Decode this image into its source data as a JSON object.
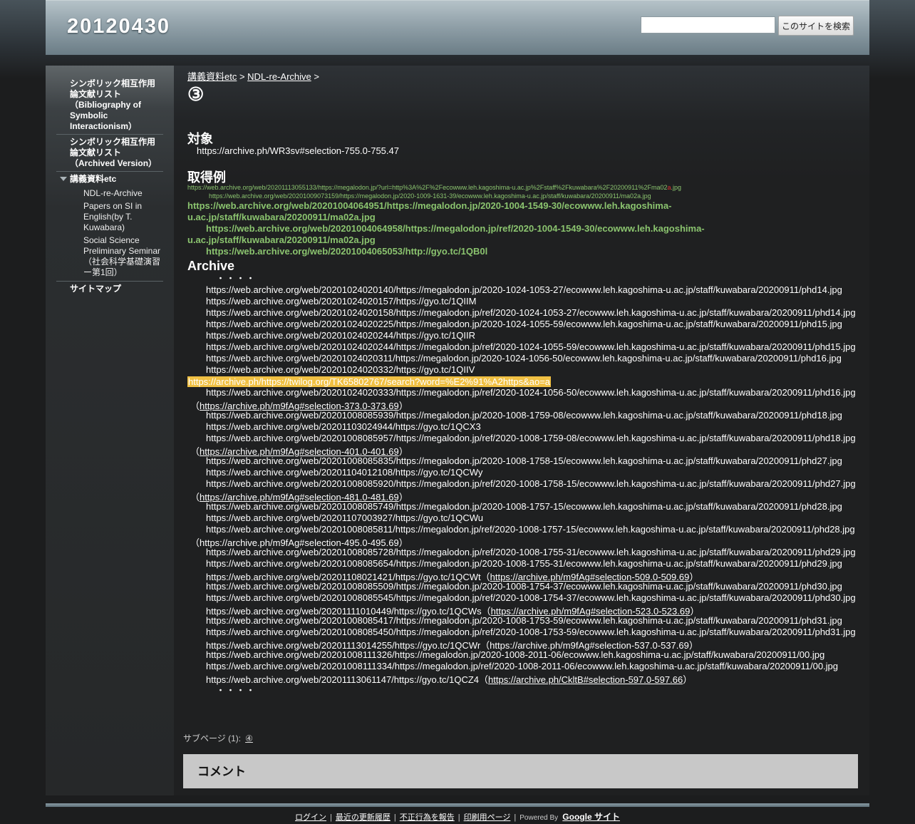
{
  "site": {
    "title": "20120430"
  },
  "search": {
    "value": "",
    "button_label": "このサイトを検索"
  },
  "sidebar": {
    "items": [
      "シンボリック相互作用論文献リスト（Bibliography of Symbolic Interactionism）",
      "シンボリック相互作用論文献リスト（Archived Version）",
      "講義資料etc",
      "NDL-re-Archive",
      "Papers on SI in English(by T. Kuwabara)",
      "Social Science Preliminary Seminar（社会科学基礎演習ー第1回）",
      "サイトマップ"
    ]
  },
  "breadcrumb": {
    "item1": "講義資料etc",
    "sep": " > ",
    "item2": "NDL-re-Archive",
    "trail": " >"
  },
  "page": {
    "title": "③"
  },
  "sections": {
    "target_heading": "対象",
    "target_url": "https://archive.ph/WR3sv#selection-755.0-755.47",
    "example_heading": "取得例",
    "archive_heading": "Archive"
  },
  "examples": {
    "tiny1": "https://web.archive.org/web/20201113055133/https://megalodon.jp/?url=http%3A%2F%2Fecowww.leh.kagoshima-u.ac.jp%2Fstaff%2Fkuwabara%2F20200911%2Fma02",
    "tiny1_mark": "a",
    "tiny1_end": ".jpg",
    "tiny2": "https://web.archive.org/web/20201009073159/https://megalodon.jp/2020-1009-1631-39/ecowww.leh.kagoshima-u.ac.jp/staff/kuwabara/20200911/ma02a.jpg",
    "b1": "https://web.archive.org/web/20201004064951/https://megalodon.jp/2020-1004-1549-30/ecowww.leh.kagoshima-u.ac.jp/staff/kuwabara/20200911/ma02a.jpg",
    "b2": "https://web.archive.org/web/20201004064958/https://megalodon.jp/ref/2020-1004-1549-30/ecowww.leh.kagoshima-u.ac.jp/staff/kuwabara/20200911/ma02a.jpg",
    "b3": "https://web.archive.org/web/20201004065053/http://gyo.tc/1QB0l"
  },
  "archive": {
    "dots": "・・・・",
    "l01": "https://web.archive.org/web/20201024020140/https://megalodon.jp/2020-1024-1053-27/ecowww.leh.kagoshima-u.ac.jp/staff/kuwabara/20200911/phd14.jpg",
    "l02": "https://web.archive.org/web/20201024020157/https://gyo.tc/1QIIM",
    "l03": "https://web.archive.org/web/20201024020158/https://megalodon.jp/ref/2020-1024-1053-27/ecowww.leh.kagoshima-u.ac.jp/staff/kuwabara/20200911/phd14.jpg",
    "l04": "https://web.archive.org/web/20201024020225/https://megalodon.jp/2020-1024-1055-59/ecowww.leh.kagoshima-u.ac.jp/staff/kuwabara/20200911/phd15.jpg",
    "l05": "https://web.archive.org/web/20201024020244/https://gyo.tc/1QIIR",
    "l06": "https://web.archive.org/web/20201024020244/https://megalodon.jp/ref/2020-1024-1055-59/ecowww.leh.kagoshima-u.ac.jp/staff/kuwabara/20200911/phd15.jpg",
    "l07": "https://web.archive.org/web/20201024020311/https://megalodon.jp/2020-1024-1056-50/ecowww.leh.kagoshima-u.ac.jp/staff/kuwabara/20200911/phd16.jpg",
    "l08": "https://web.archive.org/web/20201024020332/https://gyo.tc/1QIIV",
    "highlight": "https://archive.ph/https://twilog.org/TK65802767/search?word=%E2%91%A2https&ao=a",
    "l09": "https://web.archive.org/web/20201024020333/https://megalodon.jp/ref/2020-1024-1056-50/ecowww.leh.kagoshima-u.ac.jp/staff/kuwabara/20200911/phd16.jpg",
    "p1": "https://archive.ph/m9fAg#selection-373.0-373.69",
    "l10": "https://web.archive.org/web/20201008085939/https://megalodon.jp/2020-1008-1759-08/ecowww.leh.kagoshima-u.ac.jp/staff/kuwabara/20200911/phd18.jpg",
    "l11": "https://web.archive.org/web/20201103024944/https://gyo.tc/1QCX3",
    "l12": "https://web.archive.org/web/20201008085957/https://megalodon.jp/ref/2020-1008-1759-08/ecowww.leh.kagoshima-u.ac.jp/staff/kuwabara/20200911/phd18.jpg",
    "p2": "https://archive.ph/m9fAg#selection-401.0-401.69",
    "l13": "https://web.archive.org/web/20201008085835/https://megalodon.jp/2020-1008-1758-15/ecowww.leh.kagoshima-u.ac.jp/staff/kuwabara/20200911/phd27.jpg",
    "l14": "https://web.archive.org/web/20201104012108/https://gyo.tc/1QCWy",
    "l15": "https://web.archive.org/web/20201008085920/https://megalodon.jp/ref/2020-1008-1758-15/ecowww.leh.kagoshima-u.ac.jp/staff/kuwabara/20200911/phd27.jpg",
    "p3": "https://archive.ph/m9fAg#selection-481.0-481.69",
    "l16": "https://web.archive.org/web/20201008085749/https://megalodon.jp/2020-1008-1757-15/ecowww.leh.kagoshima-u.ac.jp/staff/kuwabara/20200911/phd28.jpg",
    "l17": "https://web.archive.org/web/20201107003927/https://gyo.tc/1QCWu",
    "l18": "https://web.archive.org/web/20201008085811/https://megalodon.jp/ref/2020-1008-1757-15/ecowww.leh.kagoshima-u.ac.jp/staff/kuwabara/20200911/phd28.jpg",
    "p4": "（https://archive.ph/m9fAg#selection-495.0-495.69）",
    "l19": "https://web.archive.org/web/20201008085728/https://megalodon.jp/ref/2020-1008-1755-31/ecowww.leh.kagoshima-u.ac.jp/staff/kuwabara/20200911/phd29.jpg",
    "l20": "https://web.archive.org/web/20201008085654/https://megalodon.jp/2020-1008-1755-31/ecowww.leh.kagoshima-u.ac.jp/staff/kuwabara/20200911/phd29.jpg",
    "l21": "https://web.archive.org/web/20201108021421/https://gyo.tc/1QCWt",
    "p5": "https://archive.ph/m9fAg#selection-509.0-509.69",
    "l22": "https://web.archive.org/web/20201008085509/https://megalodon.jp/2020-1008-1754-37/ecowww.leh.kagoshima-u.ac.jp/staff/kuwabara/20200911/phd30.jpg",
    "l23": "https://web.archive.org/web/20201008085545/https://megalodon.jp/ref/2020-1008-1754-37/ecowww.leh.kagoshima-u.ac.jp/staff/kuwabara/20200911/phd30.jpg",
    "l24": "https://web.archive.org/web/20201111010449/https://gyo.tc/1QCWs",
    "p6": "https://archive.ph/m9fAg#selection-523.0-523.69",
    "l25": "https://web.archive.org/web/20201008085417/https://megalodon.jp/2020-1008-1753-59/ecowww.leh.kagoshima-u.ac.jp/staff/kuwabara/20200911/phd31.jpg",
    "l26": "https://web.archive.org/web/20201008085450/https://megalodon.jp/ref/2020-1008-1753-59/ecowww.leh.kagoshima-u.ac.jp/staff/kuwabara/20200911/phd31.jpg",
    "l27": "https://web.archive.org/web/20201113014255/https://gyo.tc/1QCWr（https://archive.ph/m9fAg#selection-537.0-537.69）",
    "l28": "https://web.archive.org/web/20201008111326/https://megalodon.jp/2020-1008-2011-06/ecowww.leh.kagoshima-u.ac.jp/staff/kuwabara/20200911/00.jpg",
    "l29": "https://web.archive.org/web/20201008111334/https://megalodon.jp/ref/2020-1008-2011-06/ecowww.leh.kagoshima-u.ac.jp/staff/kuwabara/20200911/00.jpg",
    "l30": "https://web.archive.org/web/20201113061147/https://gyo.tc/1QCZ4",
    "p7": "https://archive.ph/CkltB#selection-597.0-597.66",
    "open_paren": "（",
    "close_paren": "）"
  },
  "subpages": {
    "label": "サブページ (1):",
    "link": "④"
  },
  "comments": {
    "heading": "コメント"
  },
  "footer": {
    "login": "ログイン",
    "recent": "最近の更新履歴",
    "report": "不正行為を報告",
    "print": "印刷用ページ",
    "powered": "Powered By",
    "google_sites": "Google サイト",
    "sep": "|"
  }
}
